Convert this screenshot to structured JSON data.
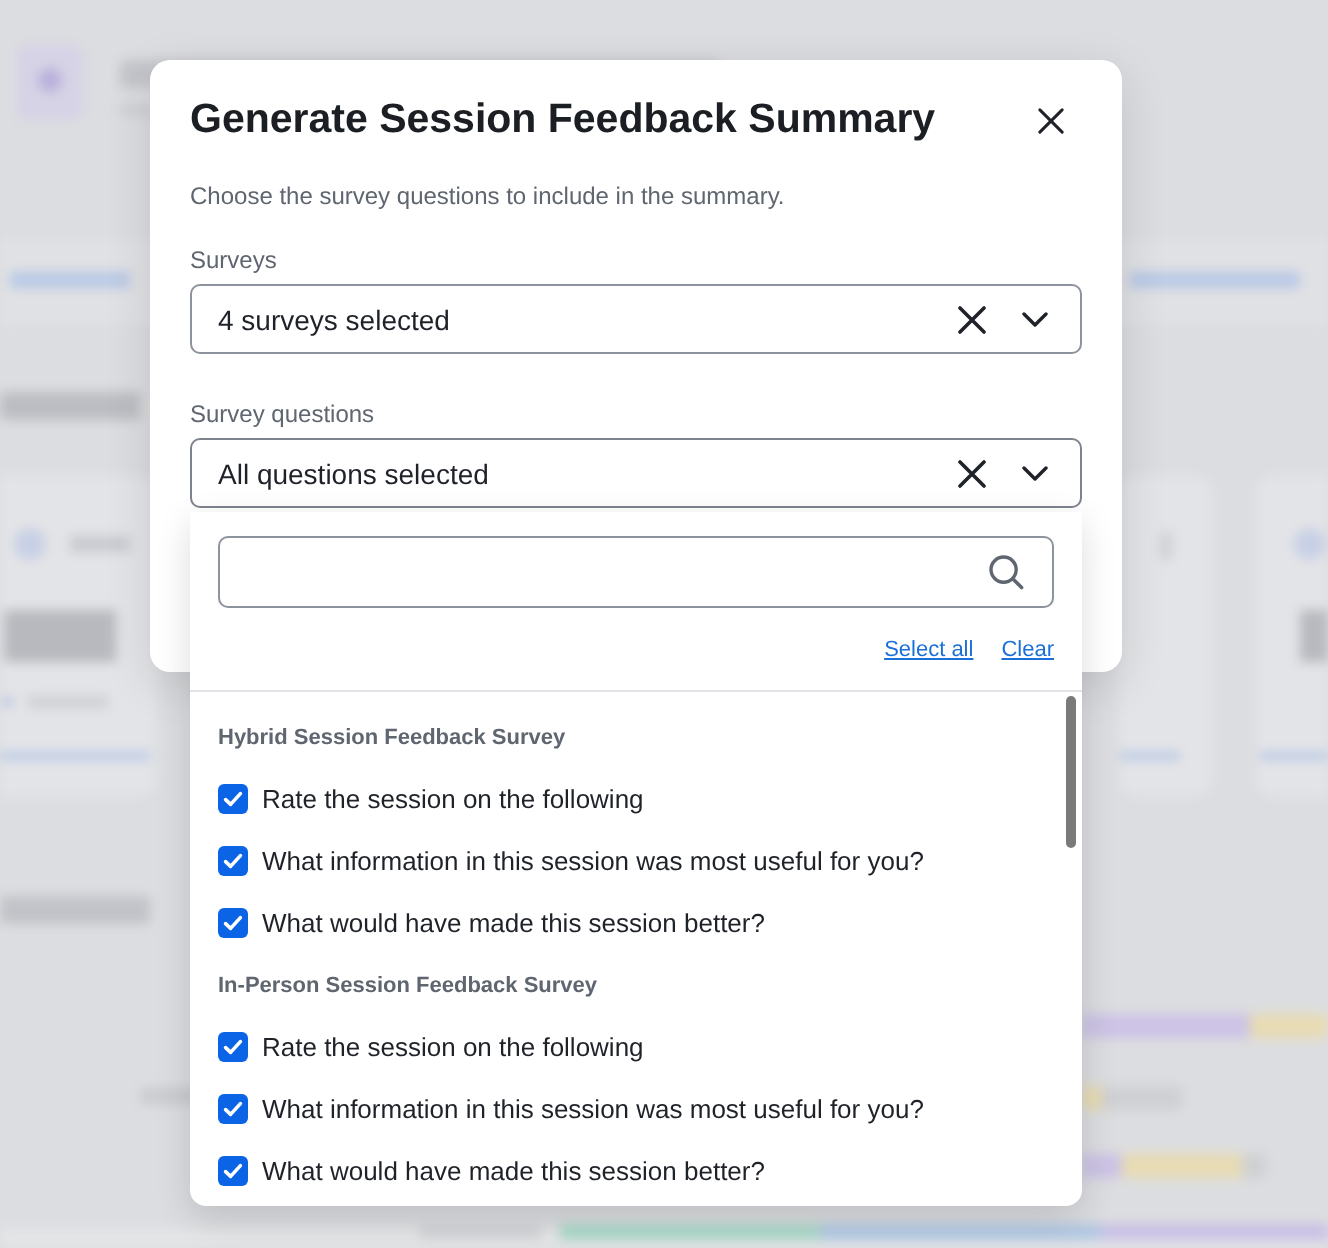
{
  "dialog": {
    "title": "Generate Session Feedback Summary",
    "description": "Choose the survey questions to include in the summary.",
    "fields": [
      {
        "label": "Surveys",
        "value": "4 surveys selected",
        "open": false
      },
      {
        "label": "Survey questions",
        "value": "All questions selected",
        "open": true
      }
    ],
    "dropdown": {
      "links": [
        "Select all",
        "Clear"
      ],
      "groups": [
        {
          "title": "Hybrid Session Feedback Survey",
          "options": [
            {
              "label": "Rate the session on the following",
              "checked": true
            },
            {
              "label": "What information in this session was most useful for you?",
              "checked": true
            },
            {
              "label": "What would have made this session better?",
              "checked": true
            }
          ]
        },
        {
          "title": "In-Person Session Feedback Survey",
          "options": [
            {
              "label": "Rate the session on the following",
              "checked": true
            },
            {
              "label": "What information in this session was most useful for you?",
              "checked": true
            },
            {
              "label": "What would have made this session better?",
              "checked": true
            }
          ]
        }
      ]
    }
  }
}
